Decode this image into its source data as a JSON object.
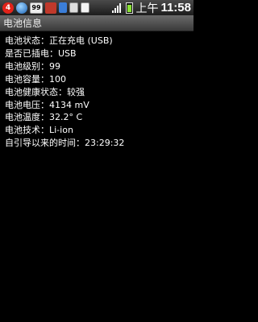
{
  "status_bar": {
    "notification_count": "4",
    "box_badge": "99",
    "ampm": "上午",
    "time": "11:58",
    "icons": [
      "notification-badge-icon",
      "globe-icon",
      "app-99-icon",
      "red-app-icon",
      "phone-icon",
      "sdcard-icon",
      "document-icon",
      "signal-icon",
      "battery-icon"
    ]
  },
  "title": "电池信息",
  "rows": [
    {
      "label": "电池状态：",
      "value": "正在充电 (USB)"
    },
    {
      "label": "是否已插电：",
      "value": "USB"
    },
    {
      "label": "电池级别：",
      "value": "99"
    },
    {
      "label": "电池容量：",
      "value": "100"
    },
    {
      "label": "电池健康状态：",
      "value": "较强"
    },
    {
      "label": "电池电压：",
      "value": "4134 mV"
    },
    {
      "label": "电池温度：",
      "value": "32.2° C"
    },
    {
      "label": "电池技术：",
      "value": "Li-ion"
    },
    {
      "label": "自引导以来的时间：",
      "value": "23:29:32"
    }
  ]
}
